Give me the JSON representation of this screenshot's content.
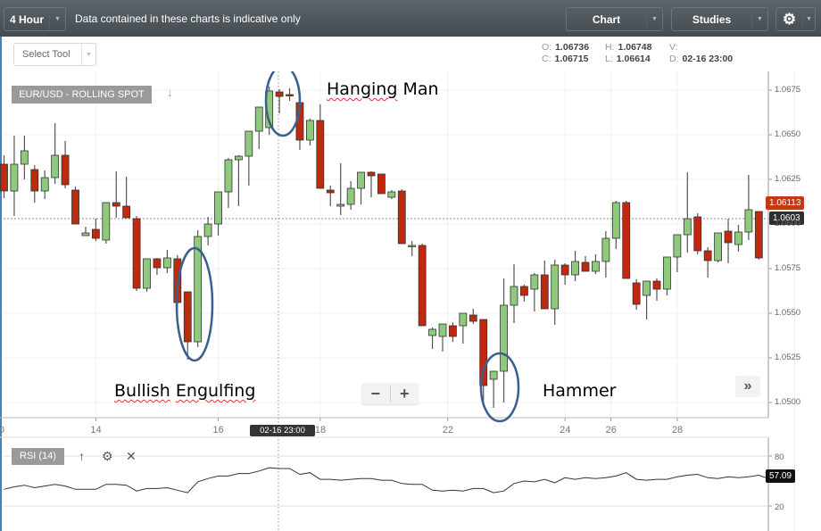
{
  "toolbar": {
    "timeframe": "4 Hour",
    "disclaimer": "Data contained in these charts is indicative only",
    "chart_button": "Chart",
    "studies_button": "Studies",
    "settings_icon": "gear-icon",
    "dropdown_icon": "caret-down-icon",
    "select_tool": "Select Tool"
  },
  "ohlc": {
    "o_label": "O:",
    "o_value": "1.06736",
    "h_label": "H:",
    "h_value": "1.06748",
    "v_label": "V:",
    "v_value": "",
    "c_label": "C:",
    "c_value": "1.06715",
    "l_label": "L:",
    "l_value": "1.06614",
    "d_label": "D:",
    "d_value": "02-16 23:00"
  },
  "symbol": "EUR/USD - ROLLING SPOT",
  "annotations": {
    "hanging_man_a": "Hanging",
    "hanging_man_b": "Man",
    "bullish_a": "Bullish",
    "bullish_b": "Engulfing",
    "hammer": "Hammer"
  },
  "controls": {
    "zoom_out": "−",
    "zoom_in": "+",
    "forward": "»"
  },
  "crosshair_time": "02-16 23:00",
  "last_price_label": "1.06113",
  "crosshair_price_label": "1.0603",
  "rsi": {
    "label": "RSI (14)",
    "up_icon": "↑",
    "gear_icon": "⚙",
    "close_icon": "✕",
    "value_label": "57.09",
    "ticks": [
      "80",
      "20"
    ]
  },
  "colors": {
    "bull": "#8fc97c",
    "bear": "#bf2a0f",
    "annotation_ring": "#3a5f8f",
    "last_price": "#c23a14"
  },
  "chart_data": {
    "type": "candlestick",
    "title": "EUR/USD - ROLLING SPOT",
    "timeframe": "4 Hour",
    "ylim": [
      1.049,
      1.069
    ],
    "yticks": [
      "1.0675",
      "1.0650",
      "1.0625",
      "1.0600",
      "1.0575",
      "1.0550",
      "1.0525",
      "1.0500"
    ],
    "xticks": [
      {
        "label": "0",
        "index": -0.5
      },
      {
        "label": "14",
        "index": 9
      },
      {
        "label": "16",
        "index": 21
      },
      {
        "label": "18",
        "index": 31
      },
      {
        "label": "22",
        "index": 43.5
      },
      {
        "label": "24",
        "index": 55
      },
      {
        "label": "26",
        "index": 59.5
      },
      {
        "label": "28",
        "index": 66
      }
    ],
    "candles": [
      {
        "o": 1.06335,
        "h": 1.06385,
        "l": 1.06145,
        "c": 1.06185
      },
      {
        "o": 1.06185,
        "h": 1.06495,
        "l": 1.06045,
        "c": 1.06335
      },
      {
        "o": 1.06335,
        "h": 1.06495,
        "l": 1.0625,
        "c": 1.0641
      },
      {
        "o": 1.06305,
        "h": 1.0633,
        "l": 1.0612,
        "c": 1.06185
      },
      {
        "o": 1.06185,
        "h": 1.063,
        "l": 1.0614,
        "c": 1.0626
      },
      {
        "o": 1.0626,
        "h": 1.06565,
        "l": 1.06225,
        "c": 1.06385
      },
      {
        "o": 1.06385,
        "h": 1.06465,
        "l": 1.062,
        "c": 1.0622
      },
      {
        "o": 1.0619,
        "h": 1.0621,
        "l": 1.06015,
        "c": 1.06
      },
      {
        "o": 1.05935,
        "h": 1.05985,
        "l": 1.05945,
        "c": 1.0595
      },
      {
        "o": 1.0597,
        "h": 1.0603,
        "l": 1.05905,
        "c": 1.0592
      },
      {
        "o": 1.0591,
        "h": 1.06065,
        "l": 1.0589,
        "c": 1.0612
      },
      {
        "o": 1.0612,
        "h": 1.06295,
        "l": 1.06035,
        "c": 1.061
      },
      {
        "o": 1.061,
        "h": 1.06265,
        "l": 1.06045,
        "c": 1.06035
      },
      {
        "o": 1.0603,
        "h": 1.06045,
        "l": 1.05625,
        "c": 1.0564
      },
      {
        "o": 1.0564,
        "h": 1.05735,
        "l": 1.0562,
        "c": 1.05805
      },
      {
        "o": 1.05805,
        "h": 1.0581,
        "l": 1.05715,
        "c": 1.05755
      },
      {
        "o": 1.05755,
        "h": 1.05855,
        "l": 1.05725,
        "c": 1.0581
      },
      {
        "o": 1.05805,
        "h": 1.05825,
        "l": 1.0546,
        "c": 1.0556
      },
      {
        "o": 1.0562,
        "h": 1.0562,
        "l": 1.0524,
        "c": 1.0534
      },
      {
        "o": 1.0534,
        "h": 1.05965,
        "l": 1.0531,
        "c": 1.0593
      },
      {
        "o": 1.0593,
        "h": 1.0604,
        "l": 1.0588,
        "c": 1.06
      },
      {
        "o": 1.06,
        "h": 1.06145,
        "l": 1.05935,
        "c": 1.0618
      },
      {
        "o": 1.0618,
        "h": 1.0637,
        "l": 1.0609,
        "c": 1.0636
      },
      {
        "o": 1.0636,
        "h": 1.06385,
        "l": 1.061,
        "c": 1.0638
      },
      {
        "o": 1.0638,
        "h": 1.0651,
        "l": 1.06215,
        "c": 1.0652
      },
      {
        "o": 1.0652,
        "h": 1.06595,
        "l": 1.0642,
        "c": 1.06655
      },
      {
        "o": 1.0654,
        "h": 1.0677,
        "l": 1.065,
        "c": 1.06745
      },
      {
        "o": 1.0674,
        "h": 1.06755,
        "l": 1.0662,
        "c": 1.06715
      },
      {
        "o": 1.06725,
        "h": 1.0676,
        "l": 1.0669,
        "c": 1.0672
      },
      {
        "o": 1.0668,
        "h": 1.06685,
        "l": 1.06415,
        "c": 1.0647
      },
      {
        "o": 1.0647,
        "h": 1.0659,
        "l": 1.0644,
        "c": 1.0658
      },
      {
        "o": 1.0658,
        "h": 1.0667,
        "l": 1.0625,
        "c": 1.062
      },
      {
        "o": 1.0619,
        "h": 1.06215,
        "l": 1.061,
        "c": 1.06175
      },
      {
        "o": 1.061,
        "h": 1.0634,
        "l": 1.0605,
        "c": 1.0611
      },
      {
        "o": 1.0611,
        "h": 1.0624,
        "l": 1.0608,
        "c": 1.062
      },
      {
        "o": 1.062,
        "h": 1.06285,
        "l": 1.0611,
        "c": 1.0629
      },
      {
        "o": 1.0629,
        "h": 1.06295,
        "l": 1.0615,
        "c": 1.0627
      },
      {
        "o": 1.0628,
        "h": 1.0624,
        "l": 1.0617,
        "c": 1.0617
      },
      {
        "o": 1.0615,
        "h": 1.0619,
        "l": 1.0614,
        "c": 1.0618
      },
      {
        "o": 1.06185,
        "h": 1.06195,
        "l": 1.0594,
        "c": 1.0589
      },
      {
        "o": 1.0588,
        "h": 1.05905,
        "l": 1.0582,
        "c": 1.0588
      },
      {
        "o": 1.0588,
        "h": 1.0589,
        "l": 1.0544,
        "c": 1.0543
      },
      {
        "o": 1.05375,
        "h": 1.0542,
        "l": 1.053,
        "c": 1.0541
      },
      {
        "o": 1.0537,
        "h": 1.05435,
        "l": 1.05285,
        "c": 1.0544
      },
      {
        "o": 1.0543,
        "h": 1.0545,
        "l": 1.0534,
        "c": 1.0537
      },
      {
        "o": 1.0543,
        "h": 1.05495,
        "l": 1.0533,
        "c": 1.055
      },
      {
        "o": 1.0549,
        "h": 1.05525,
        "l": 1.0544,
        "c": 1.05455
      },
      {
        "o": 1.05465,
        "h": 1.05465,
        "l": 1.05,
        "c": 1.05095
      },
      {
        "o": 1.0513,
        "h": 1.05165,
        "l": 1.0497,
        "c": 1.05175
      },
      {
        "o": 1.05175,
        "h": 1.05695,
        "l": 1.05,
        "c": 1.05545
      },
      {
        "o": 1.05545,
        "h": 1.05775,
        "l": 1.05445,
        "c": 1.0565
      },
      {
        "o": 1.0565,
        "h": 1.0566,
        "l": 1.05565,
        "c": 1.056
      },
      {
        "o": 1.05635,
        "h": 1.05725,
        "l": 1.0551,
        "c": 1.05715
      },
      {
        "o": 1.05715,
        "h": 1.05795,
        "l": 1.0557,
        "c": 1.05525
      },
      {
        "o": 1.05525,
        "h": 1.058,
        "l": 1.05435,
        "c": 1.0577
      },
      {
        "o": 1.0577,
        "h": 1.0578,
        "l": 1.0566,
        "c": 1.05715
      },
      {
        "o": 1.05715,
        "h": 1.0585,
        "l": 1.0568,
        "c": 1.0579
      },
      {
        "o": 1.05785,
        "h": 1.0582,
        "l": 1.05735,
        "c": 1.05735
      },
      {
        "o": 1.05735,
        "h": 1.0583,
        "l": 1.0572,
        "c": 1.0579
      },
      {
        "o": 1.0579,
        "h": 1.0596,
        "l": 1.057,
        "c": 1.0592
      },
      {
        "o": 1.0592,
        "h": 1.0613,
        "l": 1.0586,
        "c": 1.0612
      },
      {
        "o": 1.0612,
        "h": 1.0613,
        "l": 1.05705,
        "c": 1.05695
      },
      {
        "o": 1.0567,
        "h": 1.0569,
        "l": 1.0552,
        "c": 1.0555
      },
      {
        "o": 1.056,
        "h": 1.0565,
        "l": 1.05465,
        "c": 1.0568
      },
      {
        "o": 1.0568,
        "h": 1.05695,
        "l": 1.0557,
        "c": 1.05635
      },
      {
        "o": 1.05635,
        "h": 1.05805,
        "l": 1.056,
        "c": 1.05815
      },
      {
        "o": 1.05815,
        "h": 1.0588,
        "l": 1.0573,
        "c": 1.0594
      },
      {
        "o": 1.0594,
        "h": 1.0629,
        "l": 1.0584,
        "c": 1.0603
      },
      {
        "o": 1.0604,
        "h": 1.0606,
        "l": 1.0583,
        "c": 1.0585
      },
      {
        "o": 1.0585,
        "h": 1.0587,
        "l": 1.057,
        "c": 1.05795
      },
      {
        "o": 1.05795,
        "h": 1.0593,
        "l": 1.05785,
        "c": 1.0595
      },
      {
        "o": 1.0596,
        "h": 1.0603,
        "l": 1.0578,
        "c": 1.05895
      },
      {
        "o": 1.05885,
        "h": 1.05995,
        "l": 1.05845,
        "c": 1.05955
      },
      {
        "o": 1.05955,
        "h": 1.06275,
        "l": 1.0591,
        "c": 1.0608
      },
      {
        "o": 1.0607,
        "h": 1.0607,
        "l": 1.058,
        "c": 1.0581
      }
    ],
    "crosshair": {
      "index": 26.9,
      "price": 1.0603
    },
    "last_price": 1.06113,
    "rsi_series": {
      "name": "RSI (14)",
      "ylim": [
        0,
        100
      ],
      "yticks": [
        80,
        20
      ],
      "values": [
        40,
        43,
        45,
        42,
        44,
        46,
        44,
        40,
        40,
        40,
        46,
        46,
        45,
        38,
        41,
        41,
        42,
        39,
        36,
        49,
        53,
        56,
        56,
        59,
        59,
        62,
        66,
        65,
        65,
        58,
        60,
        52,
        52,
        51,
        52,
        53,
        53,
        51,
        51,
        47,
        46,
        46,
        39,
        38,
        39,
        38,
        41,
        41,
        36,
        38,
        47,
        50,
        49,
        52,
        48,
        54,
        52,
        54,
        53,
        54,
        56,
        60,
        52,
        51,
        52,
        52,
        55,
        57,
        58,
        54,
        53,
        55,
        54,
        55,
        57,
        53
      ],
      "last_value": 57.09
    }
  }
}
